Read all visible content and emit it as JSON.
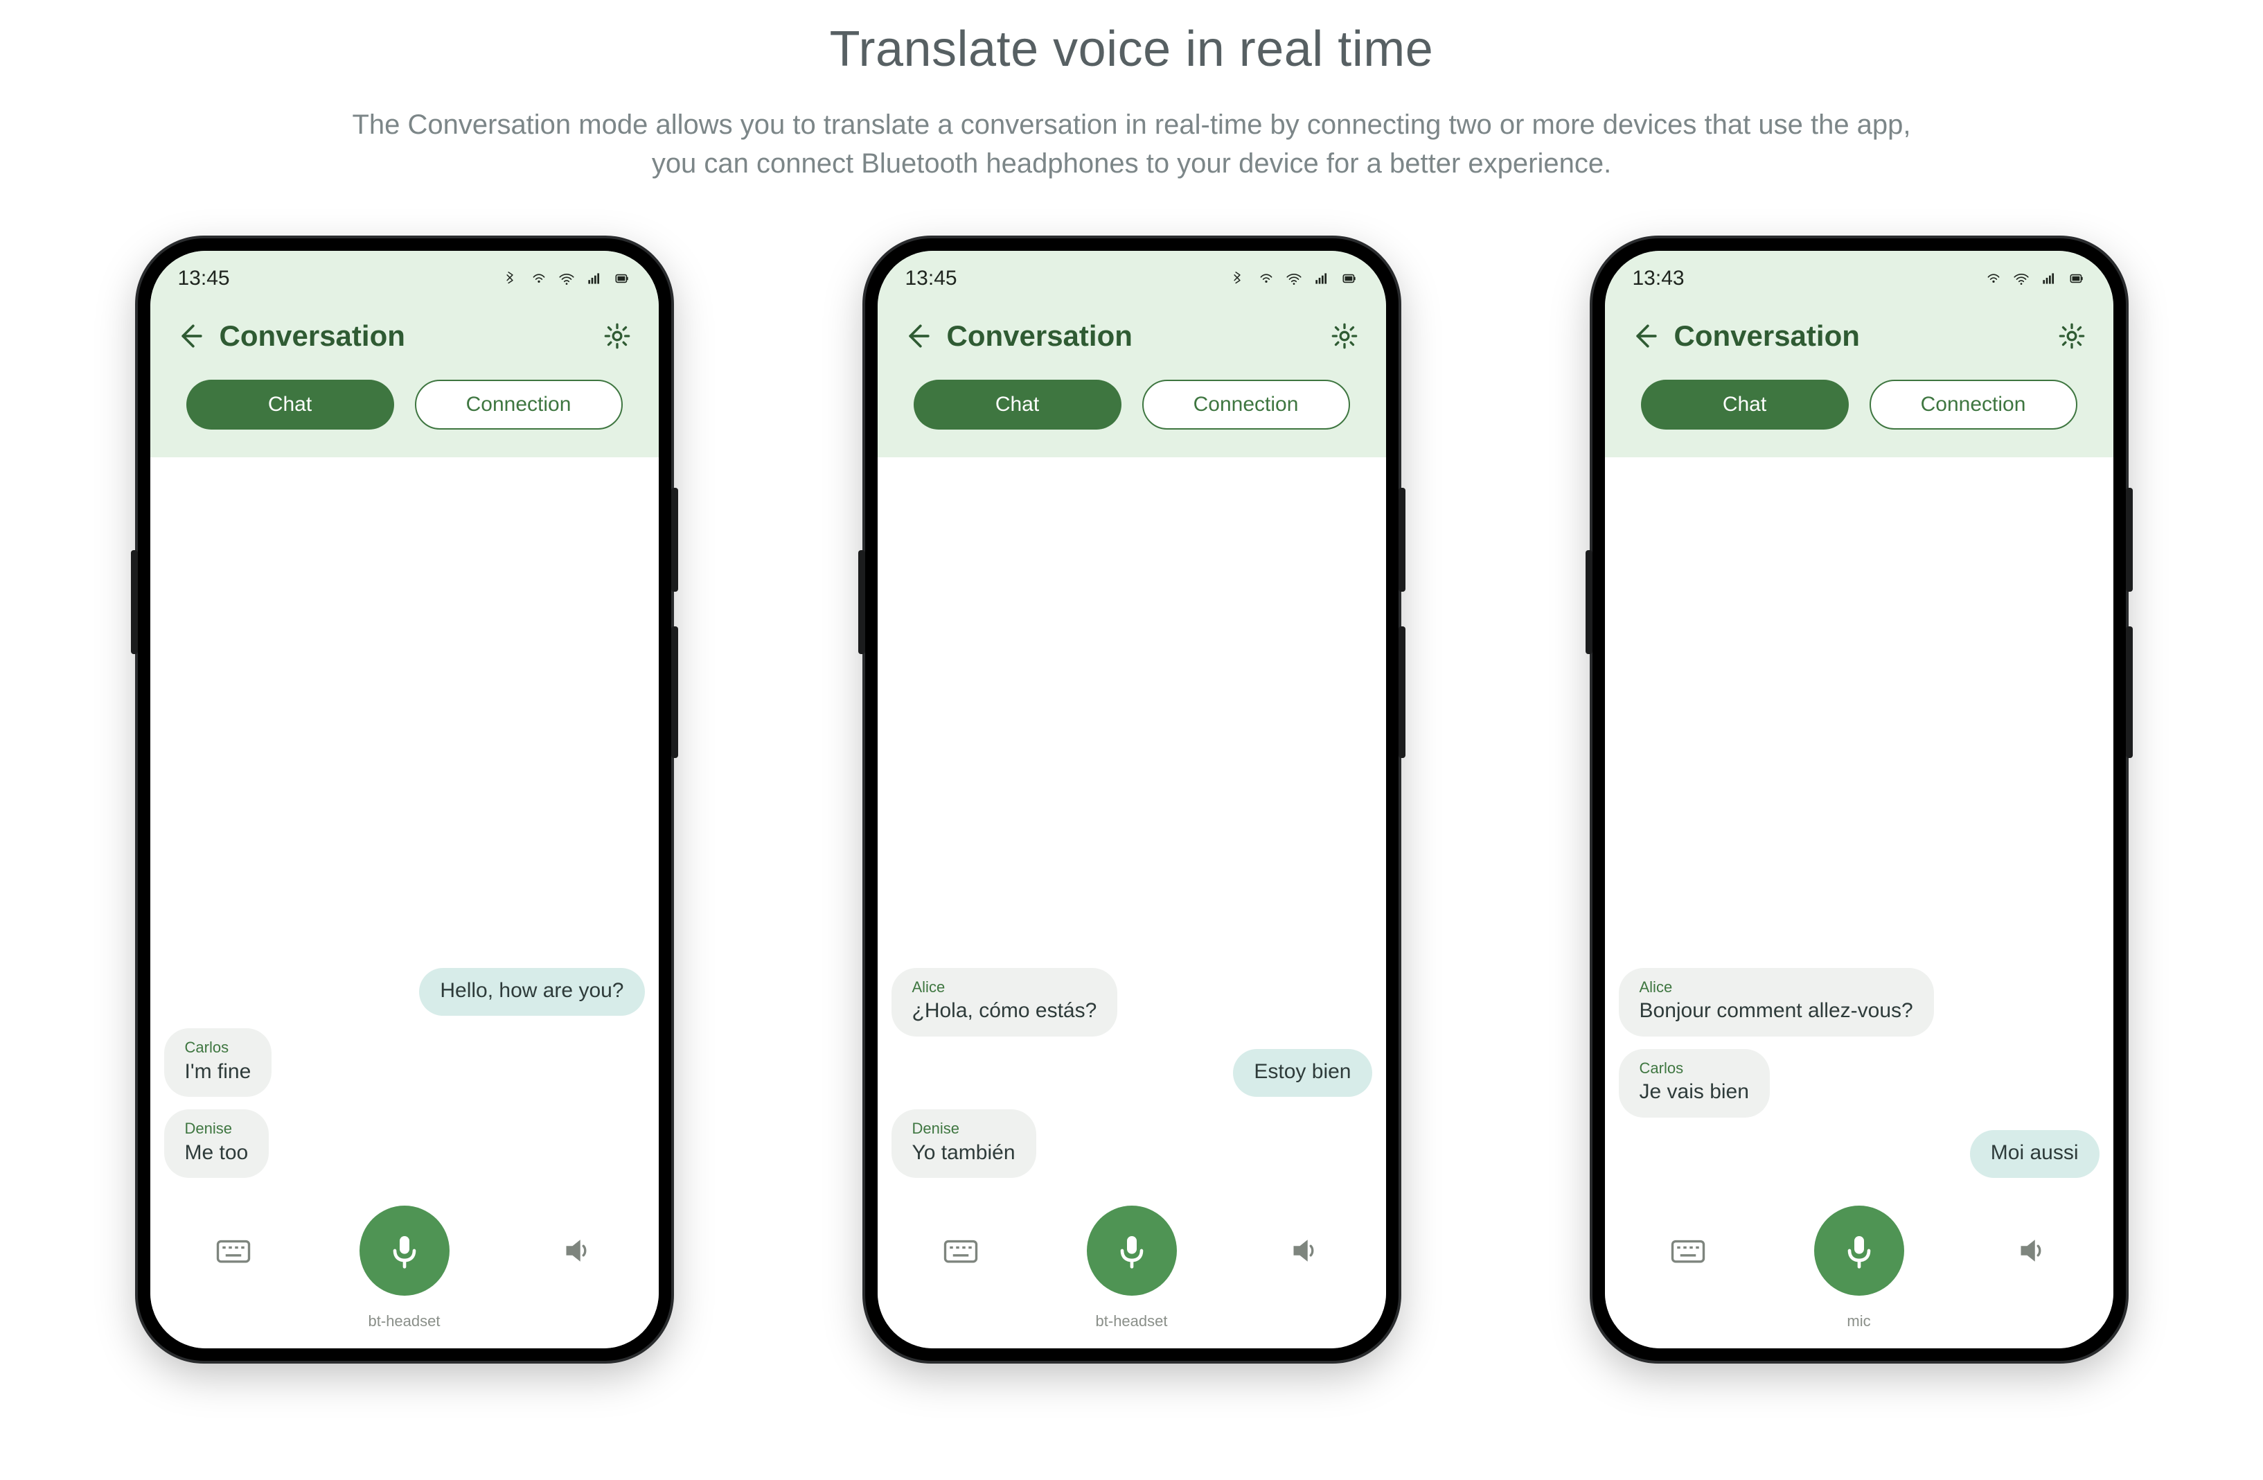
{
  "page": {
    "title": "Translate voice in real time",
    "subtitle_line1": "The Conversation mode allows you to translate a conversation in real-time by connecting two or more devices that use the app,",
    "subtitle_line2": "you can connect Bluetooth headphones to your device for a better experience."
  },
  "icons": {
    "show_bluetooth": true,
    "show_wifi_alt": true,
    "show_wifi": true,
    "show_signal": true,
    "show_battery": true
  },
  "phones": [
    {
      "status_time": "13:45",
      "status_icons": [
        "bluetooth",
        "wifi-alt",
        "wifi",
        "signal",
        "battery"
      ],
      "header_title": "Conversation",
      "tab_chat": "Chat",
      "tab_connection": "Connection",
      "messages": [
        {
          "side": "right",
          "sender": "",
          "text": "Hello, how are you?"
        },
        {
          "side": "left",
          "sender": "Carlos",
          "text": "I'm fine"
        },
        {
          "side": "left",
          "sender": "Denise",
          "text": "Me too"
        }
      ],
      "mic_label": "bt-headset"
    },
    {
      "status_time": "13:45",
      "status_icons": [
        "bluetooth",
        "wifi-alt",
        "wifi",
        "signal",
        "battery"
      ],
      "header_title": "Conversation",
      "tab_chat": "Chat",
      "tab_connection": "Connection",
      "messages": [
        {
          "side": "left",
          "sender": "Alice",
          "text": "¿Hola, cómo estás?"
        },
        {
          "side": "right",
          "sender": "",
          "text": "Estoy bien"
        },
        {
          "side": "left",
          "sender": "Denise",
          "text": "Yo también"
        }
      ],
      "mic_label": "bt-headset"
    },
    {
      "status_time": "13:43",
      "status_icons": [
        "wifi-alt",
        "wifi",
        "signal",
        "battery"
      ],
      "header_title": "Conversation",
      "tab_chat": "Chat",
      "tab_connection": "Connection",
      "messages": [
        {
          "side": "left",
          "sender": "Alice",
          "text": "Bonjour comment allez-vous?"
        },
        {
          "side": "left",
          "sender": "Carlos",
          "text": "Je vais bien"
        },
        {
          "side": "right",
          "sender": "",
          "text": "Moi aussi"
        }
      ],
      "mic_label": "mic"
    }
  ]
}
